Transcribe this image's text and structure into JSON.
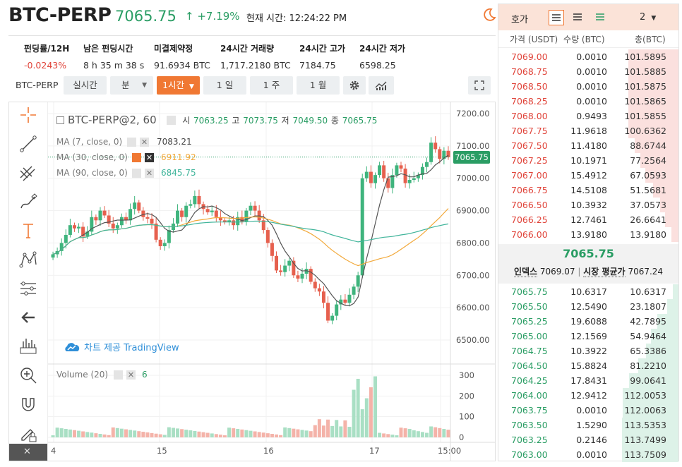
{
  "header": {
    "symbol": "BTC-PERP",
    "price": "7065.75",
    "change": "↑ +7.19%",
    "time_label": "현재 시간: 12:24:22 PM"
  },
  "stats": [
    {
      "label": "펀딩률/12H",
      "value": "-0.0243%"
    },
    {
      "label": "남은 펀딩시간",
      "value": "8 h 35 m 38 s"
    },
    {
      "label": "미결제약정",
      "value": "91.6934 BTC"
    },
    {
      "label": "24시간 거래량",
      "value": "1,717.2180 BTC"
    },
    {
      "label": "24시간 고가",
      "value": "7184.75"
    },
    {
      "label": "24시간 저가",
      "value": "6598.25"
    }
  ],
  "toolbar": {
    "symbol": "BTC-PERP",
    "realtime": "실시간",
    "minute": "분",
    "hour": "1시간",
    "day": "1 일",
    "week": "1 주",
    "month": "1 월"
  },
  "chart": {
    "title": "BTC-PERP@2, 60",
    "open_label": "시",
    "open": "7063.25",
    "high_label": "고",
    "high": "7073.75",
    "low_label": "저",
    "low": "7049.50",
    "close_label": "종",
    "close": "7065.75",
    "ma7_label": "MA (7, close, 0)",
    "ma7": "7083.21",
    "ma30_label": "MA (30, close, 0)",
    "ma30": "6911.92",
    "ma90_label": "MA (90, close, 0)",
    "ma90": "6845.75",
    "watermark": "차트 제공 TradingView",
    "volume_label": "Volume (20)",
    "volume_value": "6",
    "last_price_tag": "7065.75",
    "price_ticks": [
      "7200.00",
      "7100.00",
      "7000.00",
      "6900.00",
      "6800.00",
      "6700.00",
      "6600.00",
      "6500.00"
    ],
    "volume_ticks": [
      "300",
      "200",
      "100",
      "0"
    ],
    "time_ticks": [
      "4",
      "15",
      "16",
      "17",
      "15:00"
    ],
    "colors": {
      "up": "#3fb47d",
      "down": "#e6604e",
      "ma7": "#555555",
      "ma30": "#f2a93b",
      "ma90": "#3fb49a"
    }
  },
  "orderbook": {
    "title": "호가",
    "precision": "2",
    "col_price": "가격 (USDT)",
    "col_qty": "수량 (BTC)",
    "col_total": "총(BTC)",
    "asks": [
      {
        "price": "7069.00",
        "qty": "0.0010",
        "total": "101.5895"
      },
      {
        "price": "7068.75",
        "qty": "0.0010",
        "total": "101.5885"
      },
      {
        "price": "7068.50",
        "qty": "0.0010",
        "total": "101.5875"
      },
      {
        "price": "7068.25",
        "qty": "0.0010",
        "total": "101.5865"
      },
      {
        "price": "7068.00",
        "qty": "0.9493",
        "total": "101.5855"
      },
      {
        "price": "7067.75",
        "qty": "11.9618",
        "total": "100.6362"
      },
      {
        "price": "7067.50",
        "qty": "11.4180",
        "total": "88.6744"
      },
      {
        "price": "7067.25",
        "qty": "10.1971",
        "total": "77.2564"
      },
      {
        "price": "7067.00",
        "qty": "15.4912",
        "total": "67.0593"
      },
      {
        "price": "7066.75",
        "qty": "14.5108",
        "total": "51.5681"
      },
      {
        "price": "7066.50",
        "qty": "10.3932",
        "total": "37.0573"
      },
      {
        "price": "7066.25",
        "qty": "12.7461",
        "total": "26.6641"
      },
      {
        "price": "7066.00",
        "qty": "13.9180",
        "total": "13.9180"
      }
    ],
    "mid_price": "7065.75",
    "index_label": "인덱스",
    "index_value": "7069.07",
    "mark_label": "시장 평균가",
    "mark_value": "7067.24",
    "bids": [
      {
        "price": "7065.75",
        "qty": "10.6317",
        "total": "10.6317"
      },
      {
        "price": "7065.50",
        "qty": "12.5490",
        "total": "23.1807"
      },
      {
        "price": "7065.25",
        "qty": "19.6088",
        "total": "42.7895"
      },
      {
        "price": "7065.00",
        "qty": "12.1569",
        "total": "54.9464"
      },
      {
        "price": "7064.75",
        "qty": "10.3922",
        "total": "65.3386"
      },
      {
        "price": "7064.50",
        "qty": "15.8824",
        "total": "81.2210"
      },
      {
        "price": "7064.25",
        "qty": "17.8431",
        "total": "99.0641"
      },
      {
        "price": "7064.00",
        "qty": "12.9412",
        "total": "112.0053"
      },
      {
        "price": "7063.75",
        "qty": "0.0010",
        "total": "112.0063"
      },
      {
        "price": "7063.50",
        "qty": "1.5290",
        "total": "113.5353"
      },
      {
        "price": "7063.25",
        "qty": "0.2146",
        "total": "113.7499"
      },
      {
        "price": "7063.00",
        "qty": "0.0010",
        "total": "113.7509"
      }
    ]
  }
}
